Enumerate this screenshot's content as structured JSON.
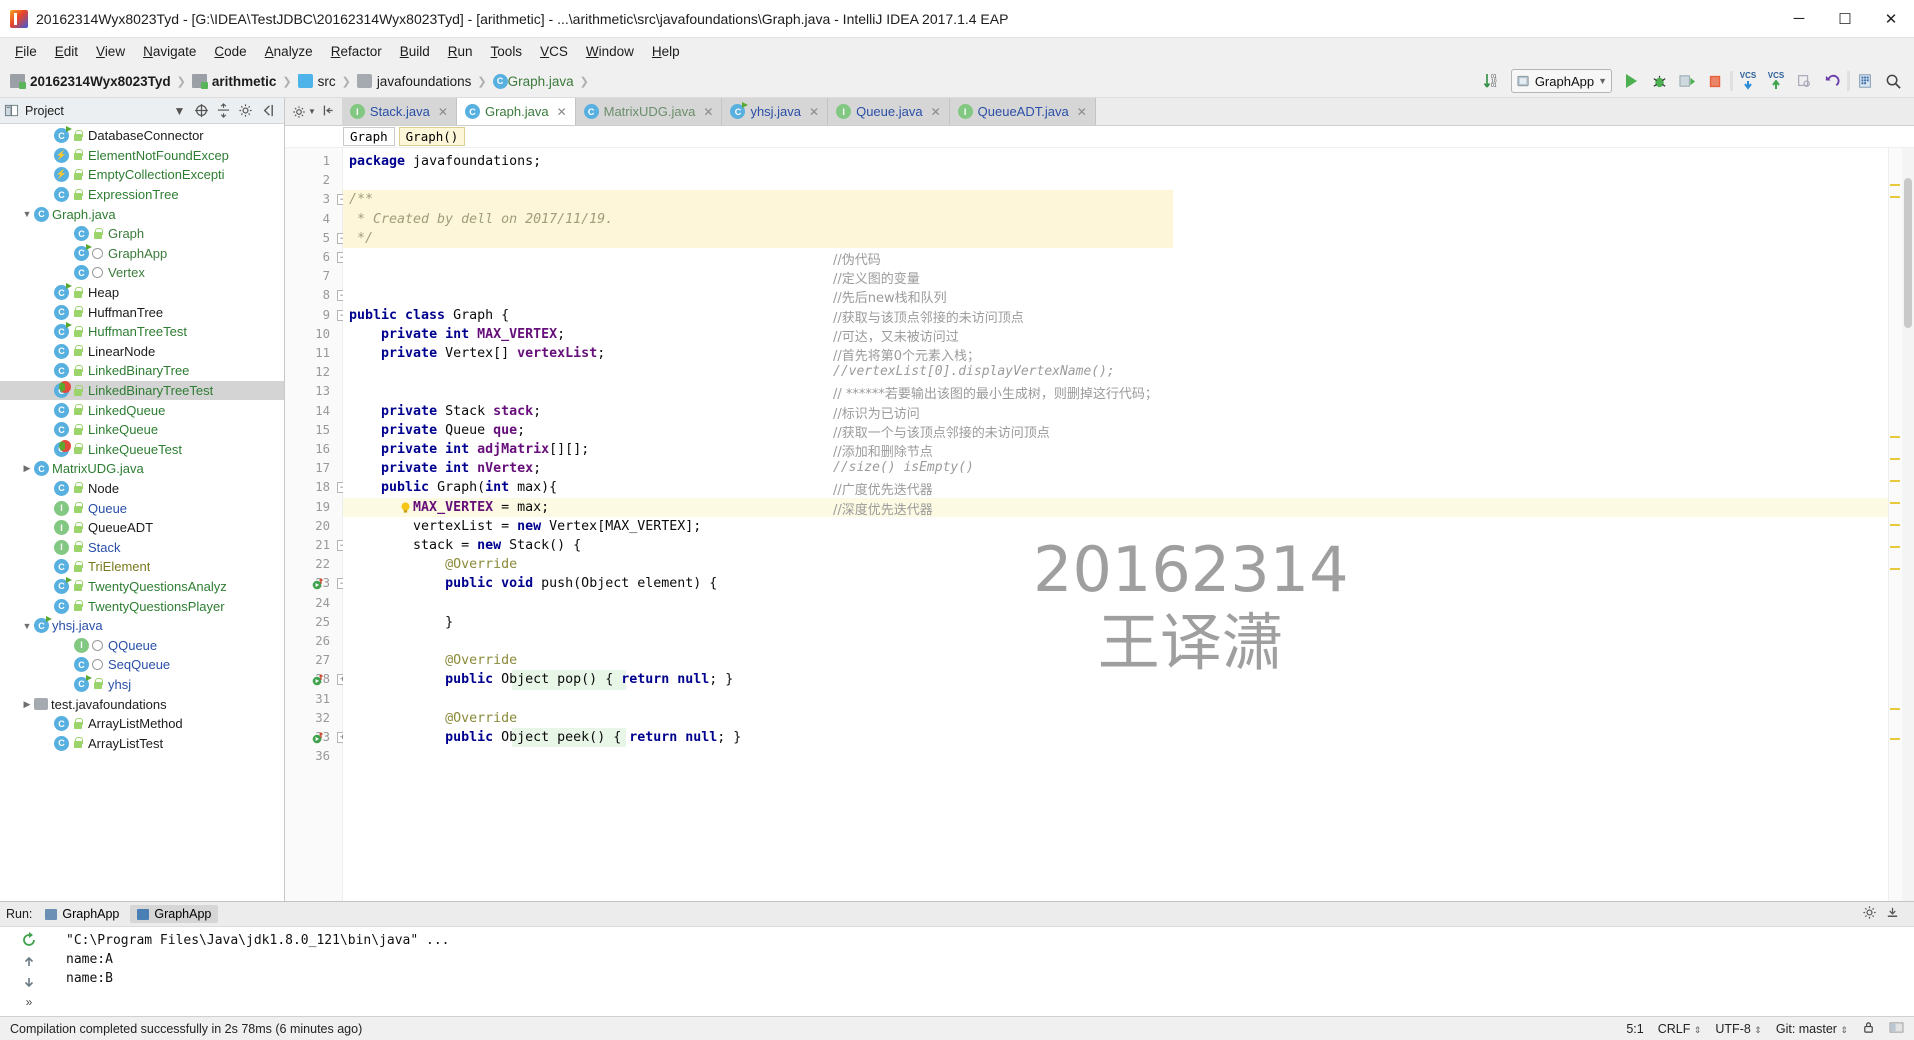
{
  "window": {
    "title": "20162314Wyx8023Tyd - [G:\\IDEA\\TestJDBC\\20162314Wyx8023Tyd] - [arithmetic] - ...\\arithmetic\\src\\javafoundations\\Graph.java - IntelliJ IDEA 2017.1.4 EAP",
    "minimize": "─",
    "maximize": "☐",
    "close": "✕"
  },
  "menubar": {
    "items": [
      "File",
      "Edit",
      "View",
      "Navigate",
      "Code",
      "Analyze",
      "Refactor",
      "Build",
      "Run",
      "Tools",
      "VCS",
      "Window",
      "Help"
    ]
  },
  "breadcrumb": {
    "items": [
      {
        "label": "20162314Wyx8023Tyd",
        "icon": "module-icon",
        "kind": "module",
        "bold": true
      },
      {
        "label": "arithmetic",
        "icon": "module-icon",
        "kind": "module",
        "bold": true
      },
      {
        "label": "src",
        "icon": "folder-icon",
        "kind": "source-folder",
        "bold": false
      },
      {
        "label": "javafoundations",
        "icon": "package-icon",
        "kind": "package",
        "bold": false
      },
      {
        "label": "Graph.java",
        "icon": "java-class-icon",
        "kind": "file",
        "bold": false
      }
    ]
  },
  "toolbar": {
    "compare_label": "10 01",
    "run_config": "GraphApp",
    "run_label": "run-button",
    "debug_label": "debug-button",
    "coverage_label": "run-with-coverage-button",
    "stop_label": "stop-button",
    "vcs_update": "VCS",
    "vcs_commit": "VCS",
    "search_label": "search-everywhere"
  },
  "sidebar": {
    "title": "Project",
    "tree": [
      {
        "label": "DatabaseConnector",
        "indent": 3,
        "icon": "class",
        "run": true,
        "lock": true,
        "color": "black",
        "twist": ""
      },
      {
        "label": "ElementNotFoundExcep",
        "indent": 3,
        "icon": "exception",
        "run": false,
        "lock": true,
        "color": "green",
        "twist": ""
      },
      {
        "label": "EmptyCollectionExcepti",
        "indent": 3,
        "icon": "exception",
        "run": false,
        "lock": true,
        "color": "green",
        "twist": ""
      },
      {
        "label": "ExpressionTree",
        "indent": 3,
        "icon": "class",
        "run": false,
        "lock": true,
        "color": "green",
        "twist": ""
      },
      {
        "label": "Graph.java",
        "indent": 2,
        "icon": "class",
        "run": false,
        "lock": false,
        "color": "green",
        "twist": "down"
      },
      {
        "label": "Graph",
        "indent": 4,
        "icon": "class",
        "run": false,
        "lock": true,
        "color": "dgreen",
        "twist": ""
      },
      {
        "label": "GraphApp",
        "indent": 4,
        "icon": "class",
        "run": true,
        "lock": false,
        "dot": true,
        "color": "dgreen",
        "twist": ""
      },
      {
        "label": "Vertex",
        "indent": 4,
        "icon": "class",
        "run": false,
        "lock": false,
        "dot": true,
        "color": "dgreen",
        "twist": ""
      },
      {
        "label": "Heap",
        "indent": 3,
        "icon": "class",
        "run": true,
        "lock": true,
        "color": "black",
        "twist": ""
      },
      {
        "label": "HuffmanTree",
        "indent": 3,
        "icon": "class",
        "run": false,
        "lock": true,
        "color": "black",
        "twist": ""
      },
      {
        "label": "HuffmanTreeTest",
        "indent": 3,
        "icon": "class",
        "run": true,
        "lock": true,
        "color": "green",
        "twist": ""
      },
      {
        "label": "LinearNode",
        "indent": 3,
        "icon": "class",
        "run": false,
        "lock": true,
        "color": "black",
        "twist": ""
      },
      {
        "label": "LinkedBinaryTree",
        "indent": 3,
        "icon": "class",
        "run": false,
        "lock": true,
        "color": "green",
        "twist": ""
      },
      {
        "label": "LinkedBinaryTreeTest",
        "indent": 3,
        "icon": "class",
        "run": true,
        "err": true,
        "lock": true,
        "color": "green",
        "twist": "",
        "selected": true
      },
      {
        "label": "LinkedQueue",
        "indent": 3,
        "icon": "class",
        "run": false,
        "lock": true,
        "color": "green",
        "twist": ""
      },
      {
        "label": "LinkeQueue",
        "indent": 3,
        "icon": "class",
        "run": false,
        "lock": true,
        "color": "green",
        "twist": ""
      },
      {
        "label": "LinkeQueueTest",
        "indent": 3,
        "icon": "class",
        "run": true,
        "err": true,
        "lock": true,
        "color": "green",
        "twist": ""
      },
      {
        "label": "MatrixUDG.java",
        "indent": 2,
        "icon": "class",
        "run": false,
        "lock": false,
        "color": "green",
        "twist": "right"
      },
      {
        "label": "Node",
        "indent": 3,
        "icon": "class",
        "run": false,
        "lock": true,
        "color": "black",
        "twist": ""
      },
      {
        "label": "Queue",
        "indent": 3,
        "icon": "interface",
        "run": false,
        "lock": true,
        "color": "blue",
        "twist": ""
      },
      {
        "label": "QueueADT",
        "indent": 3,
        "icon": "interface",
        "run": false,
        "lock": true,
        "color": "black",
        "twist": ""
      },
      {
        "label": "Stack",
        "indent": 3,
        "icon": "interface",
        "run": false,
        "lock": true,
        "color": "blue",
        "twist": ""
      },
      {
        "label": "TriElement",
        "indent": 3,
        "icon": "class",
        "run": false,
        "lock": true,
        "color": "olive",
        "twist": ""
      },
      {
        "label": "TwentyQuestionsAnalyz",
        "indent": 3,
        "icon": "class",
        "run": true,
        "lock": true,
        "color": "green",
        "twist": ""
      },
      {
        "label": "TwentyQuestionsPlayer",
        "indent": 3,
        "icon": "class",
        "run": false,
        "lock": true,
        "color": "green",
        "twist": ""
      },
      {
        "label": "yhsj.java",
        "indent": 2,
        "icon": "class",
        "run": true,
        "lock": false,
        "color": "blue",
        "twist": "down"
      },
      {
        "label": "QQueue",
        "indent": 4,
        "icon": "interface",
        "run": false,
        "lock": false,
        "dot": true,
        "color": "blue",
        "twist": ""
      },
      {
        "label": "SeqQueue",
        "indent": 4,
        "icon": "class",
        "run": false,
        "lock": false,
        "dot": true,
        "color": "blue",
        "twist": ""
      },
      {
        "label": "yhsj",
        "indent": 4,
        "icon": "class",
        "run": true,
        "lock": true,
        "color": "blue",
        "twist": ""
      },
      {
        "label": "test.javafoundations",
        "indent": 2,
        "icon": "package",
        "run": false,
        "lock": false,
        "color": "black",
        "twist": "right"
      },
      {
        "label": "ArrayListMethod",
        "indent": 3,
        "icon": "class",
        "run": false,
        "lock": true,
        "color": "black",
        "twist": ""
      },
      {
        "label": "ArrayListTest",
        "indent": 3,
        "icon": "class",
        "run": false,
        "lock": true,
        "color": "black",
        "twist": ""
      }
    ]
  },
  "editor": {
    "tabs": [
      {
        "label": "Stack.java",
        "icon": "interface",
        "active": false,
        "color": "blue"
      },
      {
        "label": "Graph.java",
        "icon": "class",
        "active": true,
        "color": "green"
      },
      {
        "label": "MatrixUDG.java",
        "icon": "class",
        "active": false,
        "color": "gray"
      },
      {
        "label": "yhsj.java",
        "icon": "class-run",
        "active": false,
        "color": "blue"
      },
      {
        "label": "Queue.java",
        "icon": "interface",
        "active": false,
        "color": "blue"
      },
      {
        "label": "QueueADT.java",
        "icon": "interface",
        "active": false,
        "color": "blue"
      }
    ],
    "member_breadcrumb": [
      "Graph",
      "Graph()"
    ],
    "lines": [
      {
        "n": "1",
        "segs": [
          {
            "t": "package",
            "c": "kw"
          },
          {
            "t": " javafoundations;",
            "c": "txt"
          }
        ]
      },
      {
        "n": "2",
        "segs": []
      },
      {
        "n": "3",
        "segs": [
          {
            "t": "/**",
            "c": "doc"
          }
        ],
        "hl": "yellow",
        "fold": "minus"
      },
      {
        "n": "4",
        "segs": [
          {
            "t": " * Created by dell on 2017/11/19.",
            "c": "doc"
          }
        ],
        "hl": "yellow"
      },
      {
        "n": "5",
        "segs": [
          {
            "t": " */",
            "c": "doc"
          }
        ],
        "hl": "yellow",
        "fold": "minus"
      },
      {
        "n": "6",
        "segs": [],
        "fold": "minus"
      },
      {
        "n": "7",
        "segs": []
      },
      {
        "n": "8",
        "segs": [],
        "fold": "minus"
      },
      {
        "n": "9",
        "segs": [
          {
            "t": "public class ",
            "c": "kw"
          },
          {
            "t": "Graph {",
            "c": "txt"
          }
        ],
        "fold": "minus"
      },
      {
        "n": "10",
        "segs": [
          {
            "t": "    ",
            "c": "txt"
          },
          {
            "t": "private int ",
            "c": "kw"
          },
          {
            "t": "MAX_VERTEX",
            "c": "field"
          },
          {
            "t": ";",
            "c": "txt"
          }
        ]
      },
      {
        "n": "11",
        "segs": [
          {
            "t": "    ",
            "c": "txt"
          },
          {
            "t": "private ",
            "c": "kw"
          },
          {
            "t": "Vertex[] ",
            "c": "txt"
          },
          {
            "t": "vertexList",
            "c": "field"
          },
          {
            "t": ";",
            "c": "txt"
          }
        ]
      },
      {
        "n": "12",
        "segs": []
      },
      {
        "n": "13",
        "segs": []
      },
      {
        "n": "14",
        "segs": [
          {
            "t": "    ",
            "c": "txt"
          },
          {
            "t": "private ",
            "c": "kw"
          },
          {
            "t": "Stack ",
            "c": "txt"
          },
          {
            "t": "stack",
            "c": "field"
          },
          {
            "t": ";",
            "c": "txt"
          }
        ]
      },
      {
        "n": "15",
        "segs": [
          {
            "t": "    ",
            "c": "txt"
          },
          {
            "t": "private ",
            "c": "kw"
          },
          {
            "t": "Queue ",
            "c": "txt"
          },
          {
            "t": "que",
            "c": "field"
          },
          {
            "t": ";",
            "c": "txt"
          }
        ]
      },
      {
        "n": "16",
        "segs": [
          {
            "t": "    ",
            "c": "txt"
          },
          {
            "t": "private int ",
            "c": "kw"
          },
          {
            "t": "adjMatrix",
            "c": "field"
          },
          {
            "t": "[][];",
            "c": "txt"
          }
        ]
      },
      {
        "n": "17",
        "segs": [
          {
            "t": "    ",
            "c": "txt"
          },
          {
            "t": "private int ",
            "c": "kw"
          },
          {
            "t": "nVertex",
            "c": "field"
          },
          {
            "t": ";",
            "c": "txt"
          }
        ]
      },
      {
        "n": "18",
        "segs": [
          {
            "t": "    ",
            "c": "txt"
          },
          {
            "t": "public ",
            "c": "kw"
          },
          {
            "t": "Graph(",
            "c": "txt"
          },
          {
            "t": "int ",
            "c": "kw"
          },
          {
            "t": "max){",
            "c": "txt"
          }
        ],
        "fold": "minus"
      },
      {
        "n": "19",
        "segs": [
          {
            "t": "        ",
            "c": "txt"
          },
          {
            "t": "MAX_VERTEX",
            "c": "field"
          },
          {
            "t": " = max;",
            "c": "txt"
          }
        ],
        "hl": "current",
        "bulb": true
      },
      {
        "n": "20",
        "segs": [
          {
            "t": "        vertexList = ",
            "c": "txt"
          },
          {
            "t": "new ",
            "c": "kw"
          },
          {
            "t": "Vertex[MAX_VERTEX];",
            "c": "txt"
          }
        ]
      },
      {
        "n": "21",
        "segs": [
          {
            "t": "        stack = ",
            "c": "txt"
          },
          {
            "t": "new ",
            "c": "kw"
          },
          {
            "t": "Stack() {",
            "c": "txt"
          }
        ],
        "fold": "minus"
      },
      {
        "n": "22",
        "segs": [
          {
            "t": "            @Override",
            "c": "ann"
          }
        ]
      },
      {
        "n": "23",
        "segs": [
          {
            "t": "            ",
            "c": "txt"
          },
          {
            "t": "public void ",
            "c": "kw"
          },
          {
            "t": "push(Object element) {",
            "c": "txt"
          }
        ],
        "gmark": true,
        "fold": "minus"
      },
      {
        "n": "24",
        "segs": []
      },
      {
        "n": "25",
        "segs": [
          {
            "t": "            }",
            "c": "txt"
          }
        ]
      },
      {
        "n": "26",
        "segs": []
      },
      {
        "n": "27",
        "segs": [
          {
            "t": "            @Override",
            "c": "ann"
          }
        ]
      },
      {
        "n": "28",
        "segs": [
          {
            "t": "            ",
            "c": "txt"
          },
          {
            "t": "public ",
            "c": "kw"
          },
          {
            "t": "Object pop() ",
            "c": "txt"
          },
          {
            "t": "{ ",
            "c": "txt"
          },
          {
            "t": "return null",
            "c": "kwret"
          },
          {
            "t": "; }",
            "c": "txt"
          }
        ],
        "gmark": true,
        "fold": "plus",
        "greenbg": true
      },
      {
        "n": "31",
        "segs": []
      },
      {
        "n": "32",
        "segs": [
          {
            "t": "            @Override",
            "c": "ann"
          }
        ]
      },
      {
        "n": "33",
        "segs": [
          {
            "t": "            ",
            "c": "txt"
          },
          {
            "t": "public ",
            "c": "kw"
          },
          {
            "t": "Object peek() ",
            "c": "txt"
          },
          {
            "t": "{ ",
            "c": "txt"
          },
          {
            "t": "return null",
            "c": "kwret"
          },
          {
            "t": "; }",
            "c": "txt"
          }
        ],
        "gmark": true,
        "fold": "plus",
        "greenbg": true
      },
      {
        "n": "36",
        "segs": []
      }
    ],
    "side_comments": [
      {
        "text": "//伪代码",
        "line": 6,
        "mono": false
      },
      {
        "text": "//定义图的变量",
        "line": 7,
        "mono": false
      },
      {
        "text": "//先后new栈和队列",
        "line": 8,
        "mono": false
      },
      {
        "text": "//获取与该顶点邻接的未访问顶点",
        "line": 9,
        "mono": false
      },
      {
        "text": "//可达，又未被访问过",
        "line": 10,
        "mono": false
      },
      {
        "text": "//首先将第0个元素入栈；",
        "line": 11,
        "mono": false
      },
      {
        "text": "//vertexList[0].displayVertexName();",
        "line": 12,
        "mono": true
      },
      {
        "text": "// ******若要输出该图的最小生成树，则删掉这行代码；",
        "line": 13,
        "mono": false
      },
      {
        "text": "//标识为已访问",
        "line": 14,
        "mono": false
      },
      {
        "text": "//获取一个与该顶点邻接的未访问顶点",
        "line": 15,
        "mono": false
      },
      {
        "text": "//添加和删除节点",
        "line": 16,
        "mono": false
      },
      {
        "text": "//size() isEmpty()",
        "line": 17,
        "mono": true
      },
      {
        "text": "//广度优先迭代器",
        "line": 18,
        "mono": false
      },
      {
        "text": "//深度优先迭代器",
        "line": 19,
        "mono": false
      }
    ],
    "watermark": {
      "line1": "20162314",
      "line2": "王译潇"
    }
  },
  "run_panel": {
    "label": "Run:",
    "tabs": [
      {
        "label": "GraphApp",
        "active": false
      },
      {
        "label": "GraphApp",
        "active": true
      }
    ],
    "console": [
      "\"C:\\Program Files\\Java\\jdk1.8.0_121\\bin\\java\" ...",
      "name:A",
      "name:B"
    ],
    "side_buttons": [
      "rerun-button",
      "up-button",
      "down-button"
    ]
  },
  "statusbar": {
    "message": "Compilation completed successfully in 2s 78ms (6 minutes ago)",
    "caret": "5:1",
    "line_separator": "CRLF",
    "encoding": "UTF-8",
    "branch": "Git: master"
  },
  "colors": {
    "accent": "#2a4fa8",
    "green": "#2e7d32",
    "highlight_yellow": "#fdf6d8",
    "selection_gray": "#d4d4d4",
    "run_green": "#4caf50",
    "error_red": "#e04b3a"
  }
}
